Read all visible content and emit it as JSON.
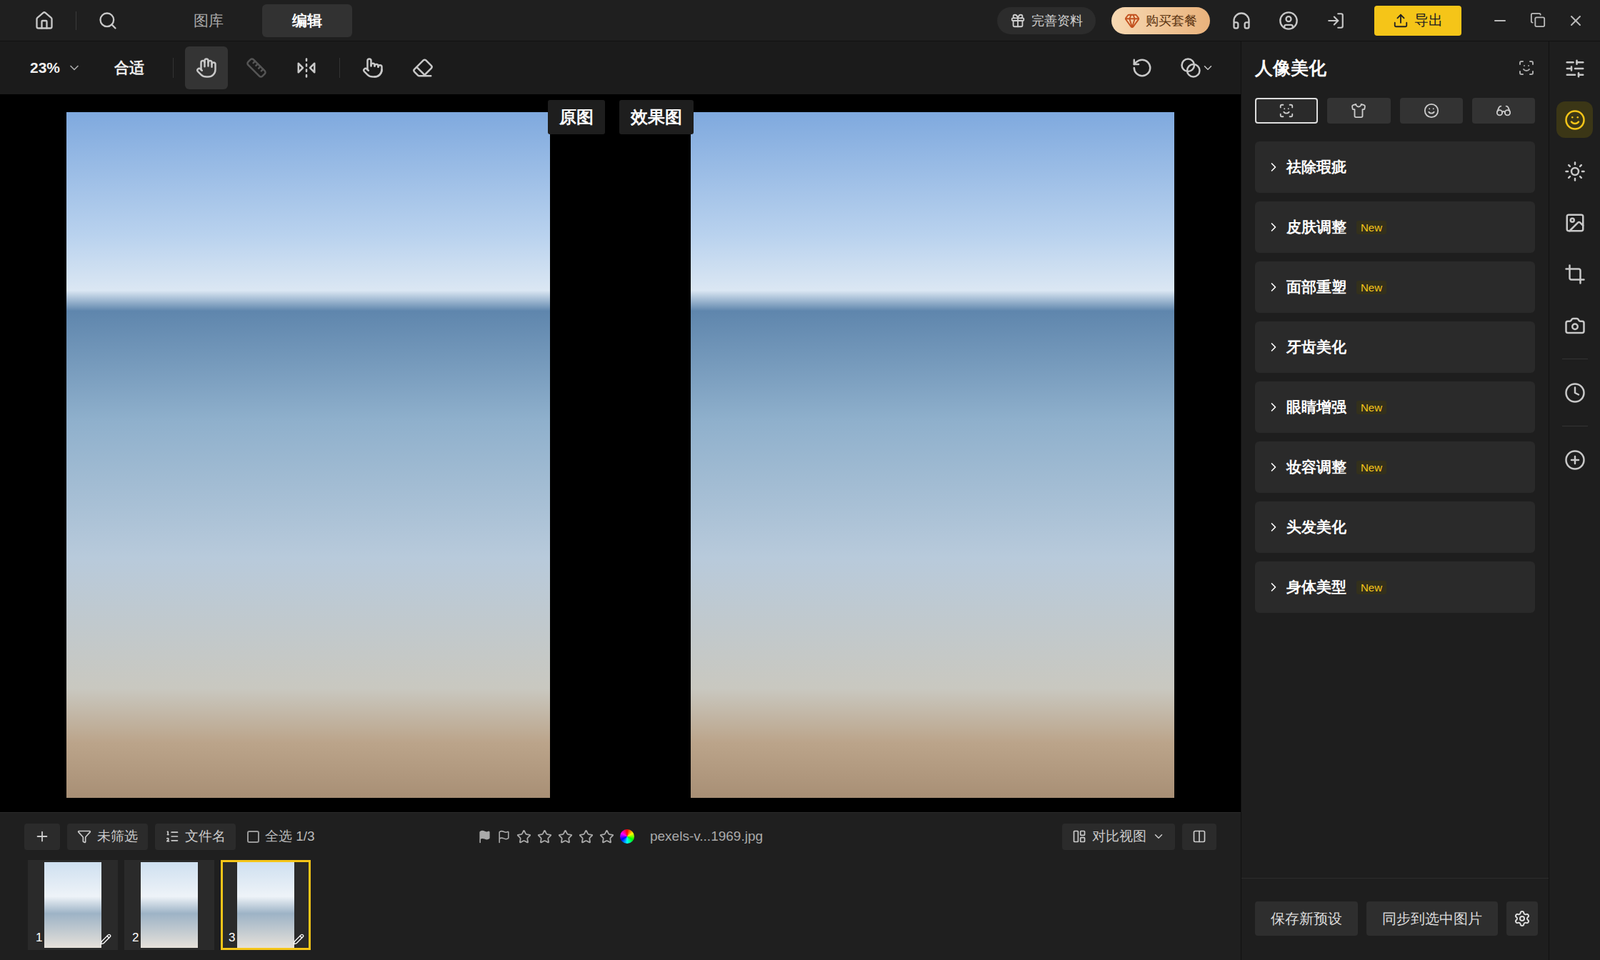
{
  "topbar": {
    "nav_tabs": [
      {
        "label": "图库",
        "selected": false
      },
      {
        "label": "编辑",
        "selected": true
      }
    ],
    "profile_button": "完善资料",
    "purchase_button": "购买套餐",
    "export_button": "导出"
  },
  "toolbar": {
    "zoom": "23%",
    "fit": "合适",
    "tools": [
      {
        "kind": "hand",
        "selected": true,
        "disabled": false
      },
      {
        "kind": "ruler",
        "selected": false,
        "disabled": true
      },
      {
        "kind": "flip",
        "selected": false,
        "disabled": false
      },
      {
        "kind": "pointer",
        "selected": false,
        "disabled": false
      },
      {
        "kind": "eraser",
        "selected": false,
        "disabled": false
      }
    ]
  },
  "canvas": {
    "original_label": "原图",
    "effect_label": "效果图"
  },
  "filmstrip": {
    "filter": "未筛选",
    "sort": "文件名",
    "select_all": {
      "label": "全选 1/3",
      "checked": false
    },
    "stars": 0,
    "filename": "pexels-v...1969.jpg",
    "view_mode": "对比视图",
    "thumbnails": [
      {
        "number": "1",
        "selected": false,
        "edited": true
      },
      {
        "number": "2",
        "selected": false,
        "edited": false
      },
      {
        "number": "3",
        "selected": true,
        "edited": true
      }
    ]
  },
  "panel": {
    "title": "人像美化",
    "tabs": [
      {
        "kind": "face",
        "selected": true
      },
      {
        "kind": "body",
        "selected": false
      },
      {
        "kind": "smile",
        "selected": false
      },
      {
        "kind": "eyes",
        "selected": false
      }
    ],
    "sections": [
      {
        "label": "祛除瑕疵",
        "expanded": false
      },
      {
        "label": "皮肤调整",
        "badge": "New",
        "expanded": false
      },
      {
        "label": "面部重塑",
        "badge": "New",
        "expanded": false
      },
      {
        "label": "牙齿美化",
        "expanded": false
      },
      {
        "label": "眼睛增强",
        "badge": "New",
        "expanded": false
      },
      {
        "label": "妆容调整",
        "badge": "New",
        "expanded": false
      },
      {
        "label": "头发美化",
        "expanded": false
      },
      {
        "label": "身体美型",
        "badge": "New",
        "expanded": false
      }
    ],
    "save_preset": "保存新预设",
    "sync": "同步到选中图片"
  },
  "sidebar": {
    "items": [
      {
        "kind": "adjust",
        "selected": false
      },
      {
        "kind": "portrait",
        "selected": true
      },
      {
        "kind": "light",
        "selected": false
      },
      {
        "kind": "image",
        "selected": false
      },
      {
        "kind": "crop",
        "selected": false
      },
      {
        "kind": "camera",
        "selected": false
      },
      {
        "kind": "history",
        "selected": false
      },
      {
        "kind": "add",
        "selected": false
      }
    ]
  }
}
